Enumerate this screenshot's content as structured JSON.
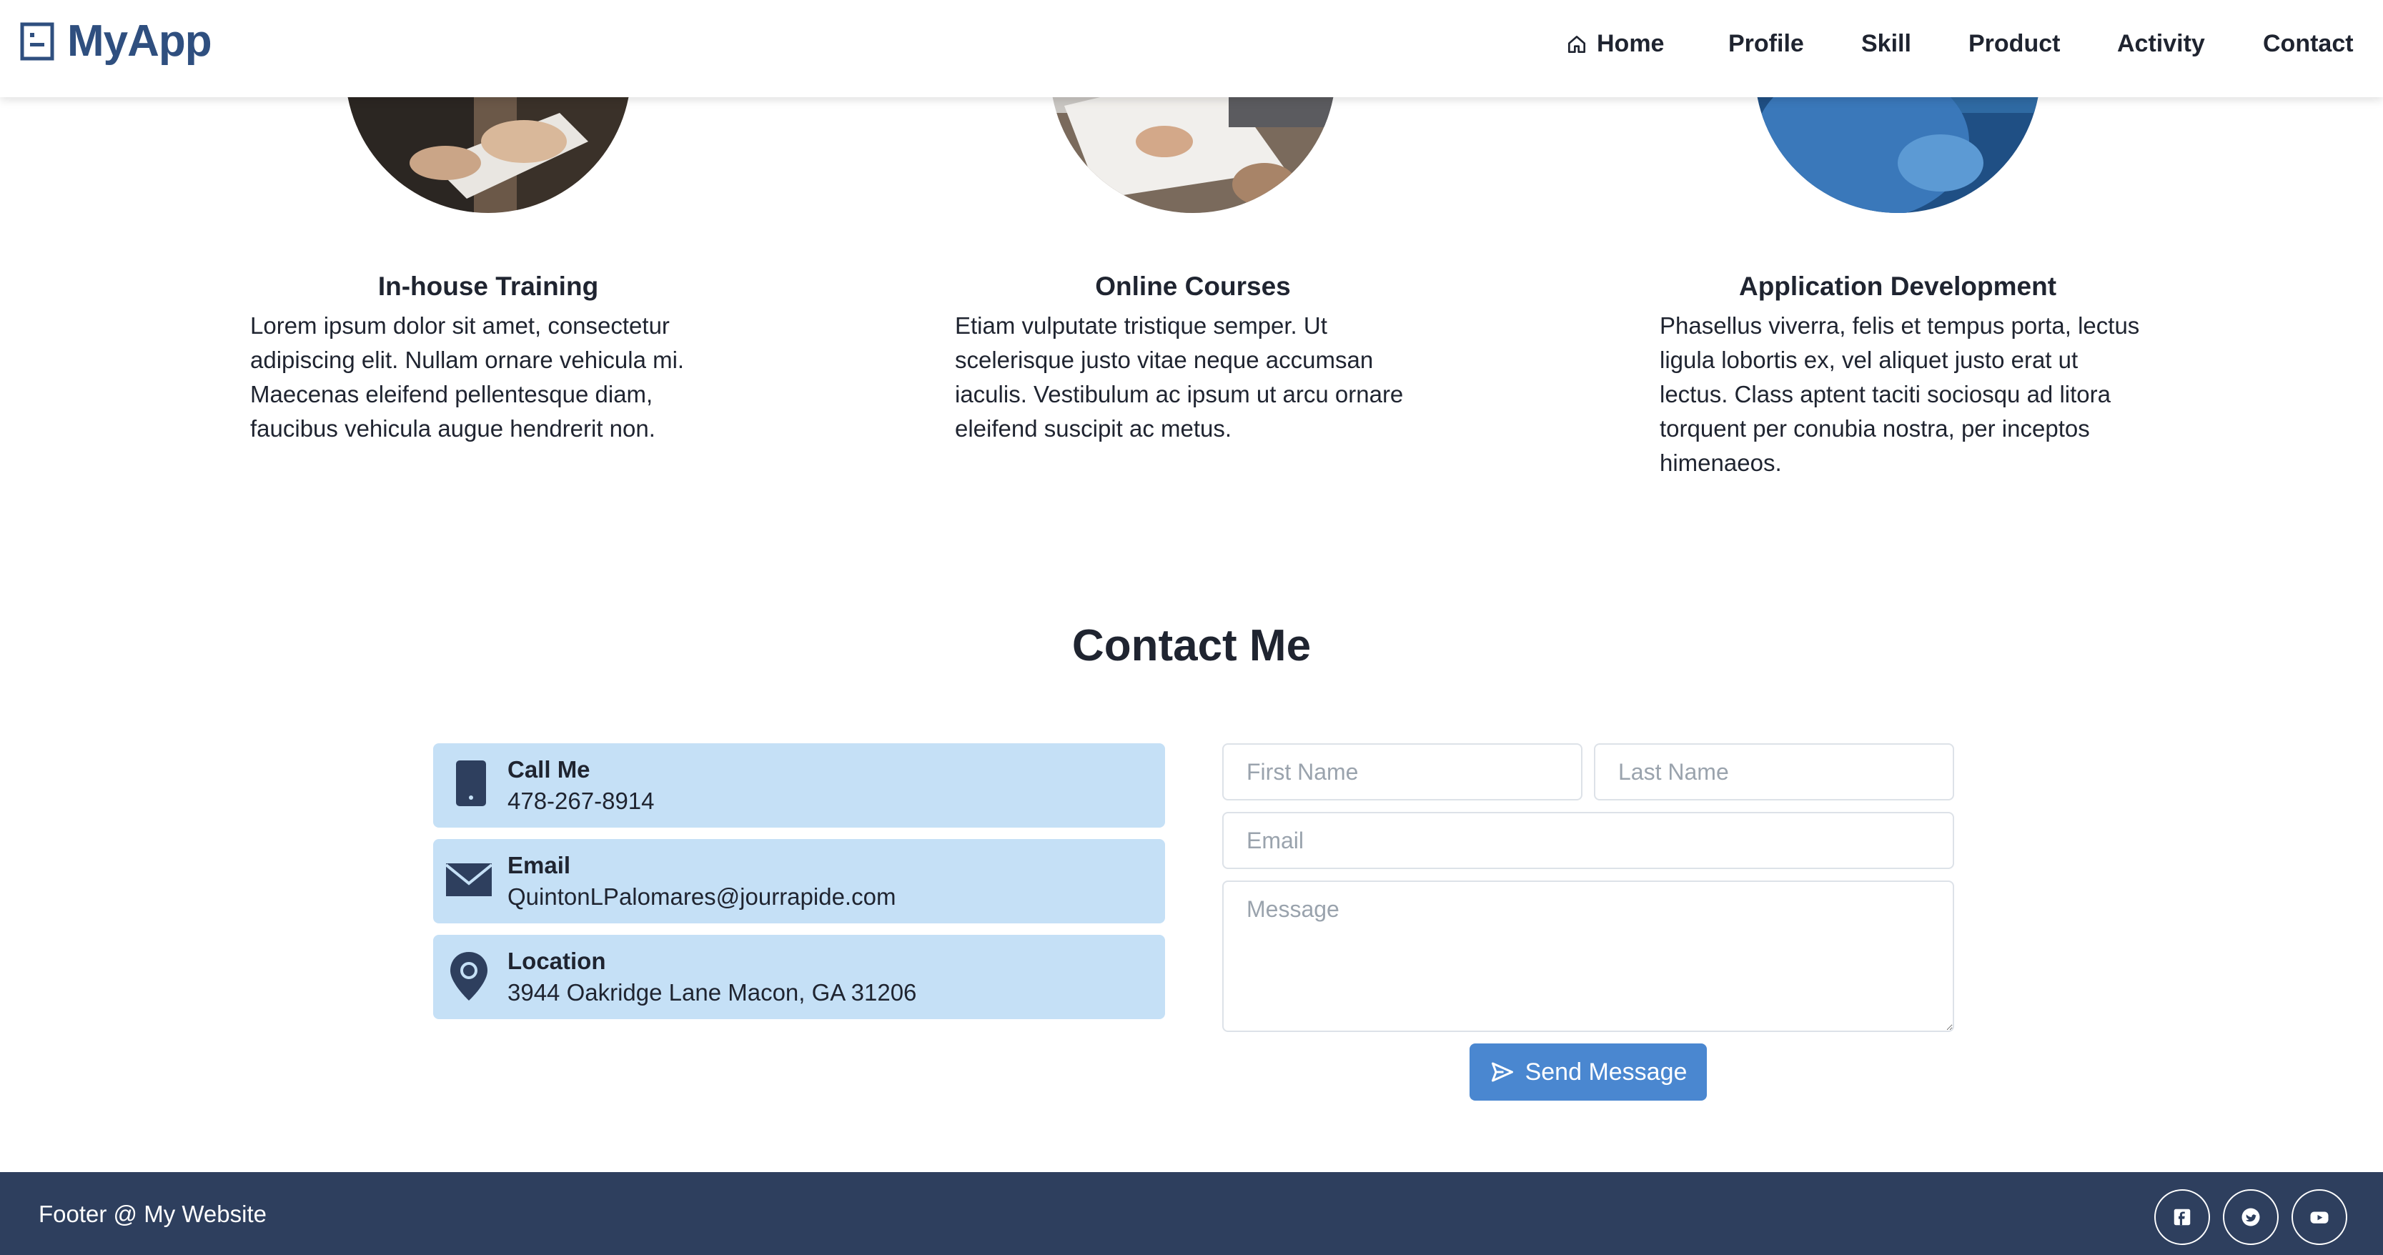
{
  "nav": {
    "brand": "MyApp",
    "links": [
      "Home",
      "Profile",
      "Skill",
      "Product",
      "Activity",
      "Contact"
    ]
  },
  "services": [
    {
      "title": "In-house Training",
      "description": "Lorem ipsum dolor sit amet, consectetur adipiscing elit. Nullam ornare vehicula mi. Maecenas eleifend pellentesque diam, faucibus vehicula augue hendrerit non."
    },
    {
      "title": "Online Courses",
      "description": "Etiam vulputate tristique semper. Ut scelerisque justo vitae neque accumsan iaculis. Vestibulum ac ipsum ut arcu ornare eleifend suscipit ac metus."
    },
    {
      "title": "Application Development",
      "description": "Phasellus viverra, felis et tempus porta, lectus ligula lobortis ex, vel aliquet justo erat ut lectus. Class aptent taciti sociosqu ad litora torquent per conubia nostra, per inceptos himenaeos."
    }
  ],
  "contact": {
    "title": "Contact Me",
    "cards": [
      {
        "label": "Call Me",
        "value": "478-267-8914",
        "icon": "phone-icon"
      },
      {
        "label": "Email",
        "value": "QuintonLPalomares@jourrapide.com",
        "icon": "envelope-icon"
      },
      {
        "label": "Location",
        "value": "3944 Oakridge Lane Macon, GA 31206",
        "icon": "map-pin-icon"
      }
    ],
    "form": {
      "first_name_placeholder": "First Name",
      "last_name_placeholder": "Last Name",
      "email_placeholder": "Email",
      "message_placeholder": "Message",
      "send_label": "Send Message"
    }
  },
  "footer": {
    "text": "Footer @ My Website",
    "socials": [
      "facebook-icon",
      "twitter-icon",
      "youtube-icon"
    ]
  },
  "colors": {
    "brand": "#2f4f7f",
    "info_card_bg": "#c5e0f6",
    "button_bg": "#4a87d0",
    "footer_bg": "#2e3f5e"
  }
}
